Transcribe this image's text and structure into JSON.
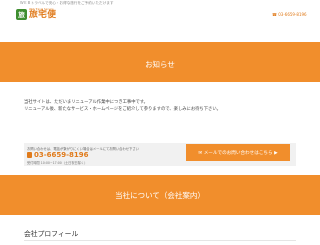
{
  "header": {
    "tagline": "ＷＥＢトラベルで安心・お得な旅行をご予約いただけます",
    "phone_top": "☎ 03-6659-8196",
    "logo": {
      "mark": "旅",
      "subtitle": "Web Travel Service",
      "text": "旅宅便"
    }
  },
  "notice": {
    "title": "お知らせ",
    "lines": [
      "当社サイトは、ただいまリニューアル作業中につき工事中です。",
      "リニューアル後、新たなサービス・ホームページをご紹介して参りますので、楽しみにお待ち下さい。"
    ]
  },
  "contact": {
    "note": "お問い合わせは、電話が繋がりにくい場合はメールにてお問い合わせ下さい",
    "phone": "03-6659-8196",
    "hours": "受付時間 10:00~17:00（土日祝日除く）",
    "mail_button": "✉ メールでのお問い合わせはこちら ▶"
  },
  "company": {
    "title": "当社について（会社案内）",
    "profile_heading": "会社プロフィール"
  },
  "colors": {
    "accent": "#f18e2c",
    "logo_green": "#3e8e2f"
  }
}
